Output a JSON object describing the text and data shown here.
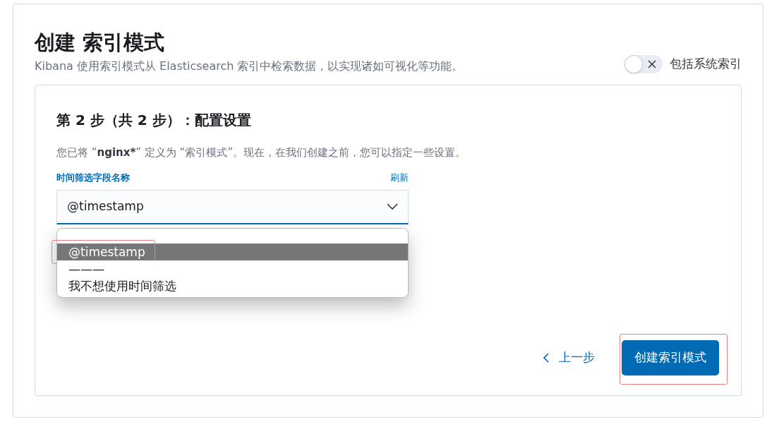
{
  "header": {
    "title": "创建 索引模式",
    "subtitle": "Kibana 使用索引模式从 Elasticsearch 索引中检索数据，以实现诸如可视化等功能。"
  },
  "system_toggle": {
    "label": "包括系统索引",
    "on": false
  },
  "step": {
    "title": "第 2 步（共 2 步）：配置设置",
    "description": {
      "before": "您已将 “",
      "pattern": "nginx*",
      "after": "” 定义为 “索引模式”。现在，在我们创建之前，您可以指定一些设置。"
    }
  },
  "time_field": {
    "label": "时间筛选字段名称",
    "refresh": "刷新",
    "value": "@timestamp",
    "expanded": true,
    "options": [
      {
        "label": "@timestamp",
        "selected": true,
        "highlighted": true
      },
      {
        "label": "———",
        "selected": false,
        "highlighted": false
      },
      {
        "label": "我不想使用时间筛选",
        "selected": false,
        "highlighted": false
      }
    ]
  },
  "buttons": {
    "back": "上一步",
    "create": "创建索引模式",
    "create_highlighted": true
  }
}
